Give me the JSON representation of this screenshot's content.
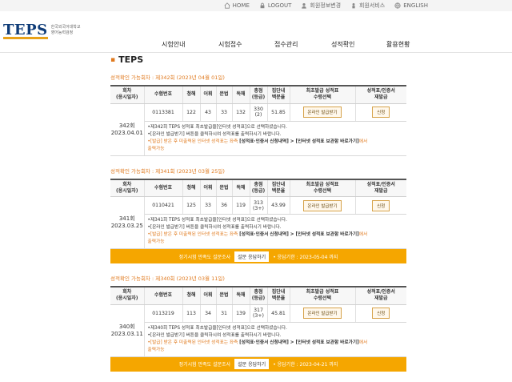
{
  "topbar": {
    "items": [
      {
        "icon": "home-icon",
        "label": "HOME"
      },
      {
        "icon": "lock-icon",
        "label": "LOGOUT"
      },
      {
        "icon": "user-icon",
        "label": "회원정보변경"
      },
      {
        "icon": "person-icon",
        "label": "회원서비스"
      },
      {
        "icon": "globe-icon",
        "label": "ENGLISH"
      }
    ]
  },
  "logo": {
    "mark": "TEPS",
    "org": "한국외국어대학교 영어능력검정"
  },
  "nav": [
    "시험안내",
    "시험접수",
    "접수관리",
    "성적확인",
    "활용현황"
  ],
  "page_title": "TEPS",
  "table_headers": {
    "round": "회차\n(응시일자)",
    "exam_no": "수험번호",
    "listening": "청해",
    "vocab": "어휘",
    "grammar": "문법",
    "reading": "독해",
    "total": "총점\n(등급)",
    "percentile": "집단내\n백분율",
    "first_issue": "최초발급 성적표\n수령선택",
    "reissue": "성적표/인증서\n재발급"
  },
  "sections": [
    {
      "header": "성적확인 가능회차 : 제342회 (2023년 04월 01일)",
      "round": "342회",
      "date": "2023.04.01",
      "exam_no": "0113381",
      "listening": "122",
      "vocab": "43",
      "grammar": "33",
      "reading": "132",
      "total": "330",
      "grade": "(2)",
      "percentile": "51.85",
      "first_btn": "온라인 발급받기",
      "reissue_btn": "신청",
      "note1": "•제342회 TEPS 성적표 최초발급을[인터넷 성적표]으로 선택하셨습니다.",
      "note2": "•[온라인 발급받기] 버튼을 클릭하시여 성적표를 출력하시기 바랍니다.",
      "note3a": "•[발급] 받은 후 미출력된 인터넷 성적표는 좌측 ",
      "note3b": "[성적표·인증서 신청내역]",
      "note3c": " > ",
      "note3d": "[인터넷 성적표 보관함 바로가기]",
      "note3e": "에서",
      "note4": "출력가능",
      "survey": null
    },
    {
      "header": "성적확인 가능회차 : 제341회 (2023년 03월 25일)",
      "round": "341회",
      "date": "2023.03.25",
      "exam_no": "0110421",
      "listening": "125",
      "vocab": "33",
      "grammar": "36",
      "reading": "119",
      "total": "313",
      "grade": "(3+)",
      "percentile": "43.99",
      "first_btn": "온라인 발급받기",
      "reissue_btn": "신청",
      "note1": "•제341회 TEPS 성적표 최초발급을[인터넷 성적표]으로 선택하셨습니다.",
      "note2": "•[온라인 발급받기] 버튼을 클릭하시여 성적표를 출력하시기 바랍니다.",
      "note3a": "•[발급] 받은 후 미출력된 인터넷 성적표는 좌측 ",
      "note3b": "[성적표·인증서 신청내역]",
      "note3c": " > ",
      "note3d": "[인터넷 성적표 보관함 바로가기]",
      "note3e": "에서",
      "note4": "출력가능",
      "survey": {
        "text": "정기시험 만족도 설문조사",
        "btn": "설문 응답하기",
        "period": "• 응답기한 : 2023-05-04 까지"
      }
    },
    {
      "header": "성적확인 가능회차 : 제340회 (2023년 03월 11일)",
      "round": "340회",
      "date": "2023.03.11",
      "exam_no": "0113219",
      "listening": "113",
      "vocab": "34",
      "grammar": "31",
      "reading": "139",
      "total": "317",
      "grade": "(3+)",
      "percentile": "45.81",
      "first_btn": "온라인 발급받기",
      "reissue_btn": "신청",
      "note1": "•제340회 TEPS 성적표 최초발급을[인터넷 성적표]으로 선택하셨습니다.",
      "note2": "•[온라인 발급받기] 버튼을 클릭하시여 성적표를 출력하시기 바랍니다.",
      "note3a": "•[발급] 받은 후 미출력된 인터넷 성적표는 좌측 ",
      "note3b": "[성적표·인증서 신청내역]",
      "note3c": " > ",
      "note3d": "[인터넷 성적표 보관함 바로가기]",
      "note3e": "에서",
      "note4": "출력가능",
      "survey": {
        "text": "정기시험 만족도 설문조사",
        "btn": "설문 응답하기",
        "period": "• 응답기한 : 2023-04-21 까지"
      }
    }
  ]
}
